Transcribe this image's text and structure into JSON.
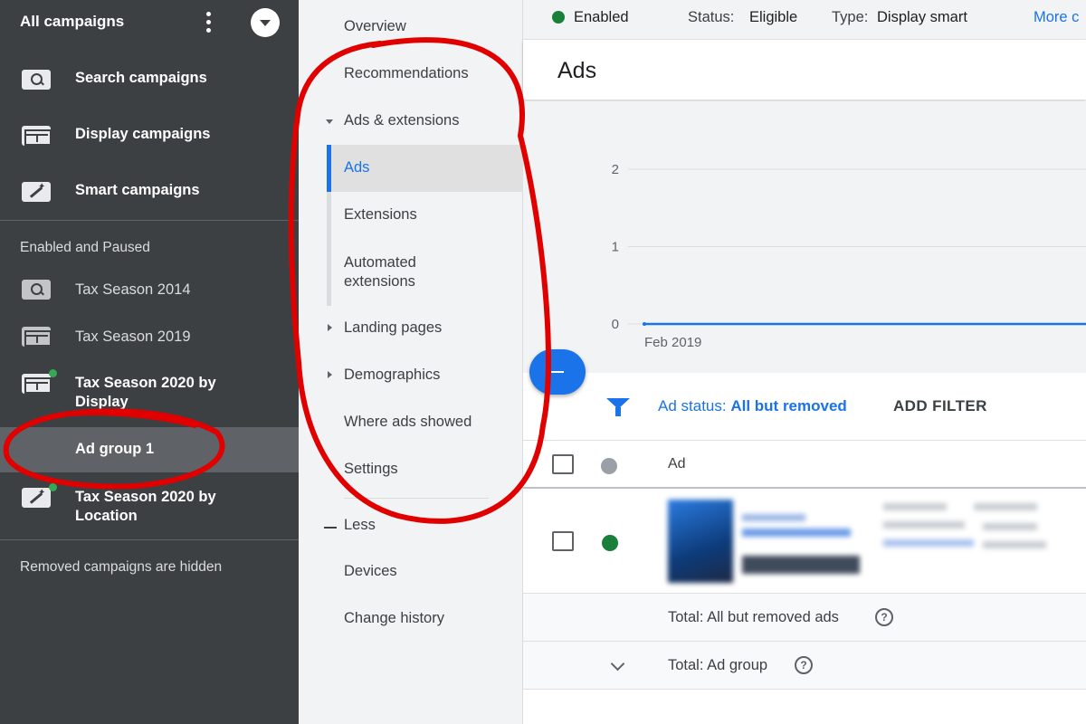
{
  "sidebar": {
    "title": "All campaigns",
    "types": [
      {
        "label": "Search campaigns",
        "icon": "search-campaign-icon"
      },
      {
        "label": "Display campaigns",
        "icon": "display-campaign-icon"
      },
      {
        "label": "Smart campaigns",
        "icon": "smart-campaign-icon"
      }
    ],
    "section_label": "Enabled and Paused",
    "campaigns": [
      {
        "label": "Tax Season 2014",
        "icon": "search-campaign-icon"
      },
      {
        "label": "Tax Season 2019",
        "icon": "display-campaign-icon"
      },
      {
        "label": "Tax Season 2020 by Display",
        "icon": "display-campaign-icon"
      },
      {
        "label": "Ad group 1"
      },
      {
        "label": "Tax Season 2020 by Location",
        "icon": "smart-campaign-icon"
      }
    ],
    "footer_note": "Removed campaigns are hidden"
  },
  "page_nav": {
    "items": [
      {
        "label": "Overview"
      },
      {
        "label": "Recommendations"
      },
      {
        "label": "Ads & extensions",
        "expanded": true
      },
      {
        "label": "Ads",
        "active": true
      },
      {
        "label": "Extensions"
      },
      {
        "label": "Automated extensions"
      },
      {
        "label": "Landing pages"
      },
      {
        "label": "Demographics"
      },
      {
        "label": "Where ads showed"
      },
      {
        "label": "Settings"
      },
      {
        "label": "Less"
      },
      {
        "label": "Devices"
      },
      {
        "label": "Change history"
      }
    ]
  },
  "topbar": {
    "status": "Enabled",
    "status_label": "Status:",
    "status_value": "Eligible",
    "type_label": "Type:",
    "type_value": "Display smart",
    "more": "More c"
  },
  "main": {
    "title": "Ads",
    "filter_prefix": "Ad status:",
    "filter_value": "All but removed",
    "add_filter": "ADD FILTER",
    "column_ad": "Ad",
    "total_ads": "Total: All but removed ads",
    "total_group": "Total: Ad group"
  },
  "colors": {
    "accent": "#1a73e8",
    "enabled_green": "#188038",
    "sidebar_bg": "#3c4043",
    "annotation_red": "#e00000"
  },
  "chart_data": {
    "type": "line",
    "x": [
      "Feb 2019"
    ],
    "y_ticks": [
      0,
      1,
      2
    ],
    "ylim": [
      0,
      2
    ],
    "series": [
      {
        "values": [
          0
        ]
      }
    ],
    "grid": true
  }
}
